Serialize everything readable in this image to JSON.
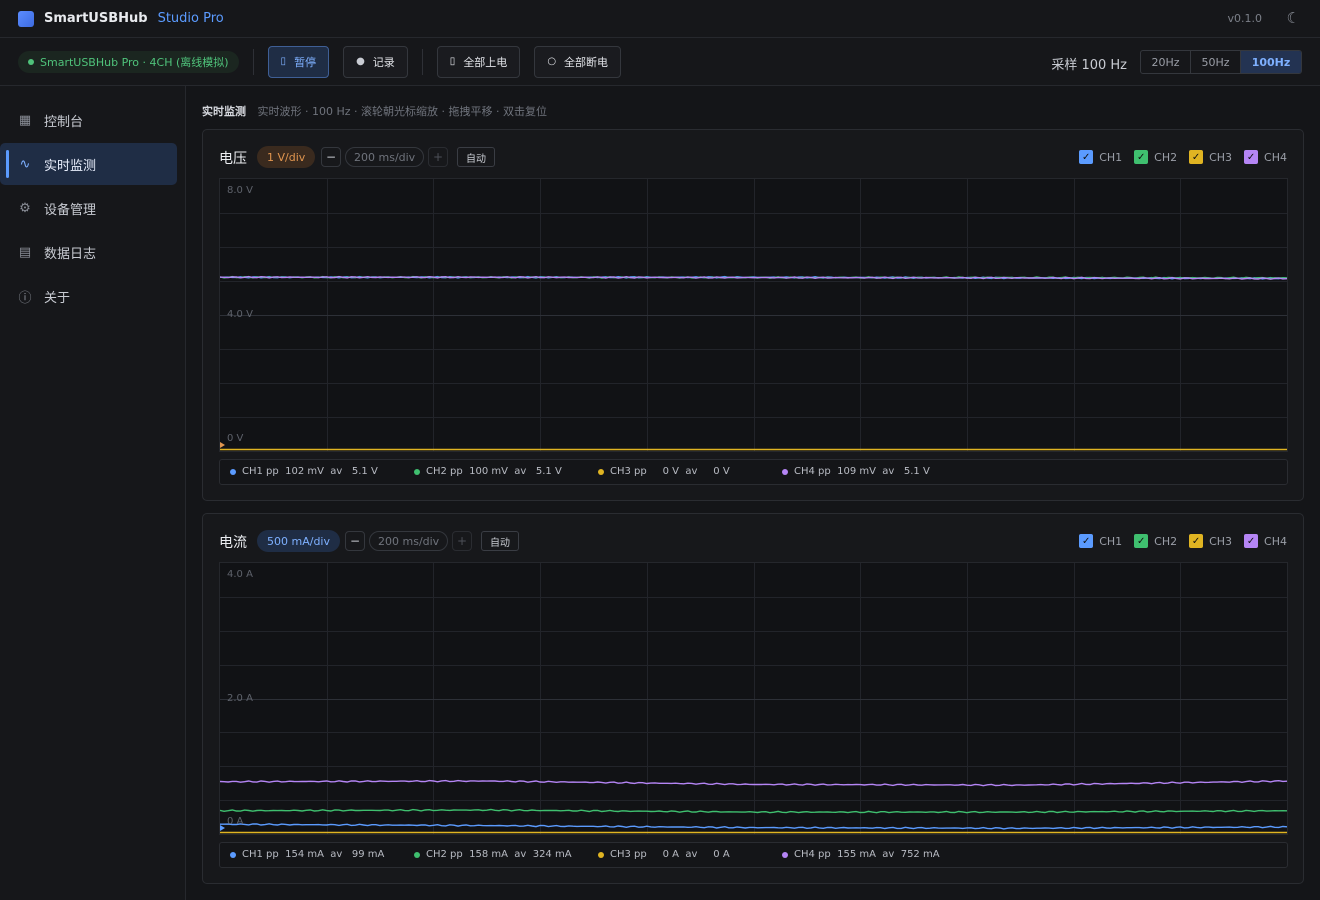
{
  "app": {
    "name": "SmartUSBHub",
    "edition": "Studio Pro",
    "version": "v0.1.0"
  },
  "toolbar": {
    "connection": "SmartUSBHub Pro · 4CH (离线模拟)",
    "pause": "暂停",
    "record": "记录",
    "power_all_on": "全部上电",
    "power_all_off": "全部断电",
    "sample_rate_label": "采样 100 Hz",
    "rates": [
      "20Hz",
      "50Hz",
      "100Hz"
    ],
    "selected_rate": "100Hz"
  },
  "sidebar": {
    "items": [
      {
        "label": "控制台",
        "icon": "grid-icon"
      },
      {
        "label": "实时监测",
        "icon": "wave-icon"
      },
      {
        "label": "设备管理",
        "icon": "gear-icon"
      },
      {
        "label": "数据日志",
        "icon": "log-icon"
      },
      {
        "label": "关于",
        "icon": "info-icon"
      }
    ],
    "active": "实时监测"
  },
  "page": {
    "title": "实时监测",
    "subtitle": "实时波形 · 100 Hz · 滚轮朝光标缩放 · 拖拽平移 · 双击复位"
  },
  "colors": {
    "CH1": "#5b9bff",
    "CH2": "#3fbf6f",
    "CH3": "#e0b422",
    "CH4": "#b585f5"
  },
  "voltage_panel": {
    "title": "电压",
    "scale": "1 V/div",
    "minus": "−",
    "timebase": "200 ms/div",
    "plus": "+",
    "auto": "自动",
    "channels": [
      "CH1",
      "CH2",
      "CH3",
      "CH4"
    ],
    "y_labels": [
      "8.0 V",
      "4.0 V",
      "0 V"
    ],
    "stats": [
      {
        "text": "CH1 pp  102 mV  av   5.1 V"
      },
      {
        "text": "CH2 pp  100 mV  av   5.1 V"
      },
      {
        "text": "CH3 pp     0 V  av     0 V"
      },
      {
        "text": "CH4 pp  109 mV  av   5.1 V"
      }
    ]
  },
  "current_panel": {
    "title": "电流",
    "scale": "500 mA/div",
    "minus": "−",
    "timebase": "200 ms/div",
    "plus": "+",
    "auto": "自动",
    "channels": [
      "CH1",
      "CH2",
      "CH3",
      "CH4"
    ],
    "y_labels": [
      "4.0 A",
      "2.0 A",
      "0 A"
    ],
    "stats": [
      {
        "text": "CH1 pp  154 mA  av   99 mA"
      },
      {
        "text": "CH2 pp  158 mA  av  324 mA"
      },
      {
        "text": "CH3 pp     0 A  av     0 A"
      },
      {
        "text": "CH4 pp  155 mA  av  752 mA"
      }
    ]
  },
  "chart_data": [
    {
      "type": "line",
      "title": "电压",
      "ylim": [
        0,
        8
      ],
      "series": [
        {
          "name": "CH1",
          "values": [
            5.1,
            5.1,
            5.1,
            5.08,
            5.07
          ]
        },
        {
          "name": "CH2",
          "values": [
            5.1,
            5.1,
            5.09,
            5.09,
            5.08
          ]
        },
        {
          "name": "CH3",
          "values": [
            0,
            0,
            0,
            0,
            0
          ]
        },
        {
          "name": "CH4",
          "values": [
            5.1,
            5.1,
            5.09,
            5.08,
            5.06
          ]
        }
      ]
    },
    {
      "type": "line",
      "title": "电流",
      "ylim": [
        0,
        4
      ],
      "series": [
        {
          "name": "CH1",
          "values": [
            0.13,
            0.11,
            0.08,
            0.07,
            0.09
          ]
        },
        {
          "name": "CH2",
          "values": [
            0.33,
            0.34,
            0.31,
            0.31,
            0.33
          ]
        },
        {
          "name": "CH3",
          "values": [
            0,
            0,
            0,
            0,
            0
          ]
        },
        {
          "name": "CH4",
          "values": [
            0.76,
            0.77,
            0.72,
            0.71,
            0.77
          ]
        }
      ]
    }
  ]
}
